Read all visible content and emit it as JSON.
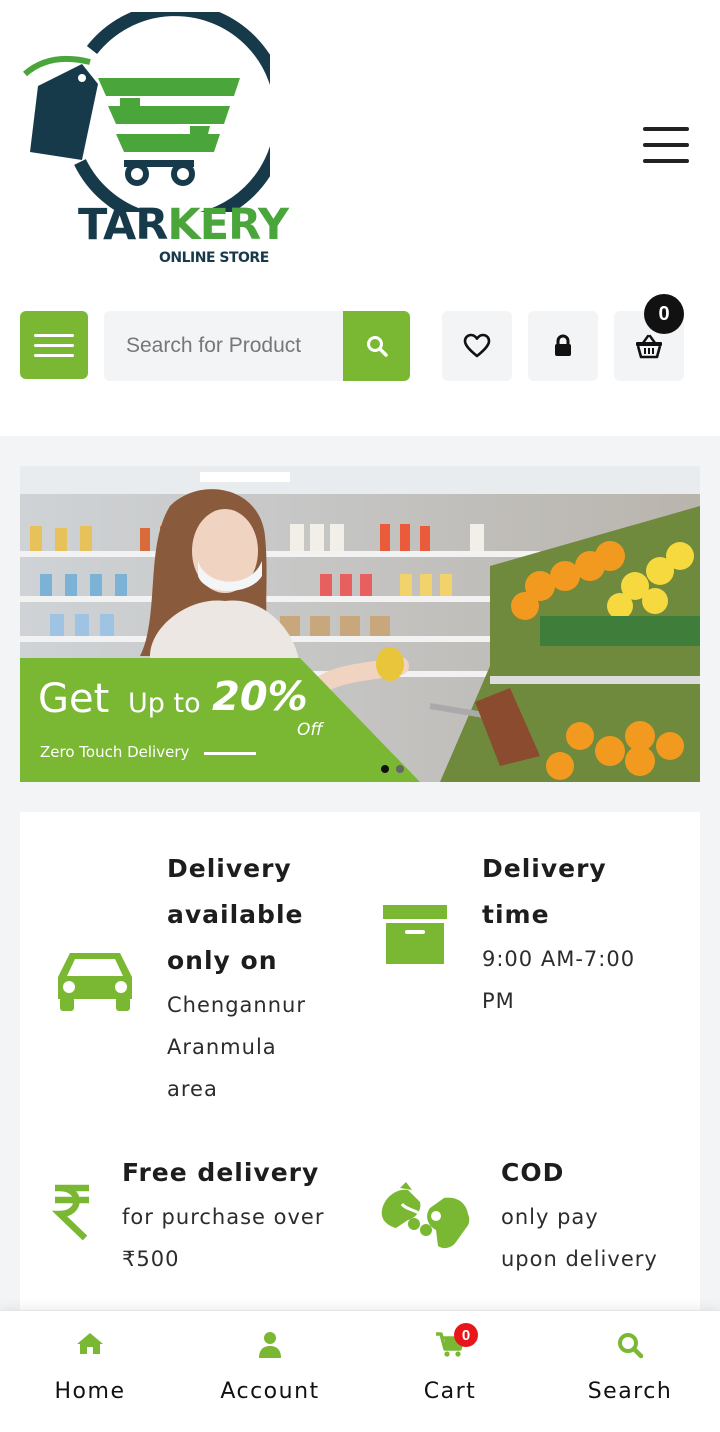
{
  "brand": {
    "name_part1": "TAR",
    "name_part2": "KERY",
    "tagline": "ONLINE STORE"
  },
  "colors": {
    "accent": "#7ab833",
    "logo_dark": "#173a4a",
    "logo_green": "#4aa53b",
    "badge_red": "#e8161b"
  },
  "header": {
    "menu_icon": "hamburger-icon"
  },
  "toolbar": {
    "menu_icon": "hamburger-icon",
    "search_placeholder": "Search for Product",
    "search_icon": "search-icon",
    "wishlist_icon": "heart-icon",
    "account_icon": "lock-icon",
    "cart_icon": "basket-icon",
    "cart_count": "0"
  },
  "banner": {
    "get": "Get",
    "upto": "Up to",
    "percent": "20%",
    "off": "Off",
    "tagline": "Zero Touch Delivery",
    "slides": 2,
    "active_slide": 1
  },
  "features": [
    {
      "icon": "car-icon",
      "title": [
        "Delivery",
        "available",
        "only on"
      ],
      "desc": [
        "Chengannur",
        "Aranmula",
        "area"
      ]
    },
    {
      "icon": "archive-box-icon",
      "title": [
        "Delivery",
        "time"
      ],
      "desc": [
        "9:00 AM-7:00",
        "PM"
      ]
    },
    {
      "icon": "rupee-icon",
      "title": [
        "Free delivery"
      ],
      "desc": [
        "for purchase over",
        "₹500"
      ]
    },
    {
      "icon": "handshake-icon",
      "title": [
        "COD"
      ],
      "desc": [
        "only pay",
        "upon delivery"
      ]
    }
  ],
  "bottom_nav": [
    {
      "label": "Home",
      "icon": "home-icon"
    },
    {
      "label": "Account",
      "icon": "user-icon"
    },
    {
      "label": "Cart",
      "icon": "cart-icon",
      "badge": "0"
    },
    {
      "label": "Search",
      "icon": "search-icon"
    }
  ]
}
